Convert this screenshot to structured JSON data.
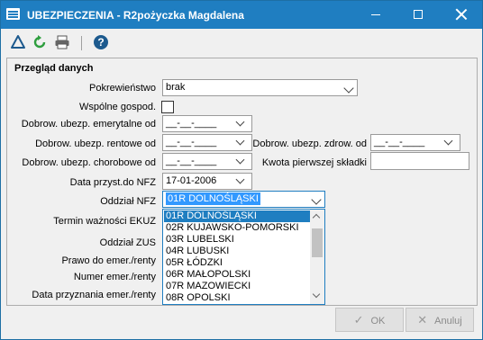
{
  "window": {
    "title": "UBEZPIECZENIA - R2pożyczka Magdalena"
  },
  "panel": {
    "title": "Przegląd danych"
  },
  "labels": {
    "pokrewienstwo": "Pokrewieństwo",
    "wspolne": "Wspólne gospod.",
    "emerytalne": "Dobrow. ubezp. emerytalne od",
    "rentowe": "Dobrow. ubezp. rentowe od",
    "zdrow": "Dobrow. ubezp. zdrow. od",
    "chorobowe": "Dobrow. ubezp. chorobowe od",
    "kwota": "Kwota pierwszej składki",
    "data_nfz": "Data przyst.do NFZ",
    "oddzial_nfz": "Oddział NFZ",
    "termin_ekuz": "Termin ważności EKUZ",
    "oddzial_zus": "Oddział ZUS",
    "prawo": "Prawo do emer./renty",
    "numer": "Numer emer./renty",
    "data_przyznania": "Data przyznania emer./renty"
  },
  "fields": {
    "pokrewienstwo": "brak",
    "emerytalne": "__-__-____",
    "rentowe": "__-__-____",
    "zdrow": "__-__-____",
    "chorobowe": "__-__-____",
    "kwota": "",
    "data_nfz": "17-01-2006",
    "oddzial_nfz": "01R DOLNOŚLĄSKI"
  },
  "dropdown_options": [
    "01R DOLNOŚLĄSKI",
    "02R KUJAWSKO-POMORSKI",
    "03R LUBELSKI",
    "04R LUBUSKI",
    "05R ŁÓDZKI",
    "06R MAŁOPOLSKI",
    "07R MAZOWIECKI",
    "08R OPOLSKI"
  ],
  "buttons": {
    "ok": "OK",
    "cancel": "Anuluj"
  },
  "colors": {
    "titlebar": "#1f7ec1",
    "selection": "#1f7ec1"
  }
}
